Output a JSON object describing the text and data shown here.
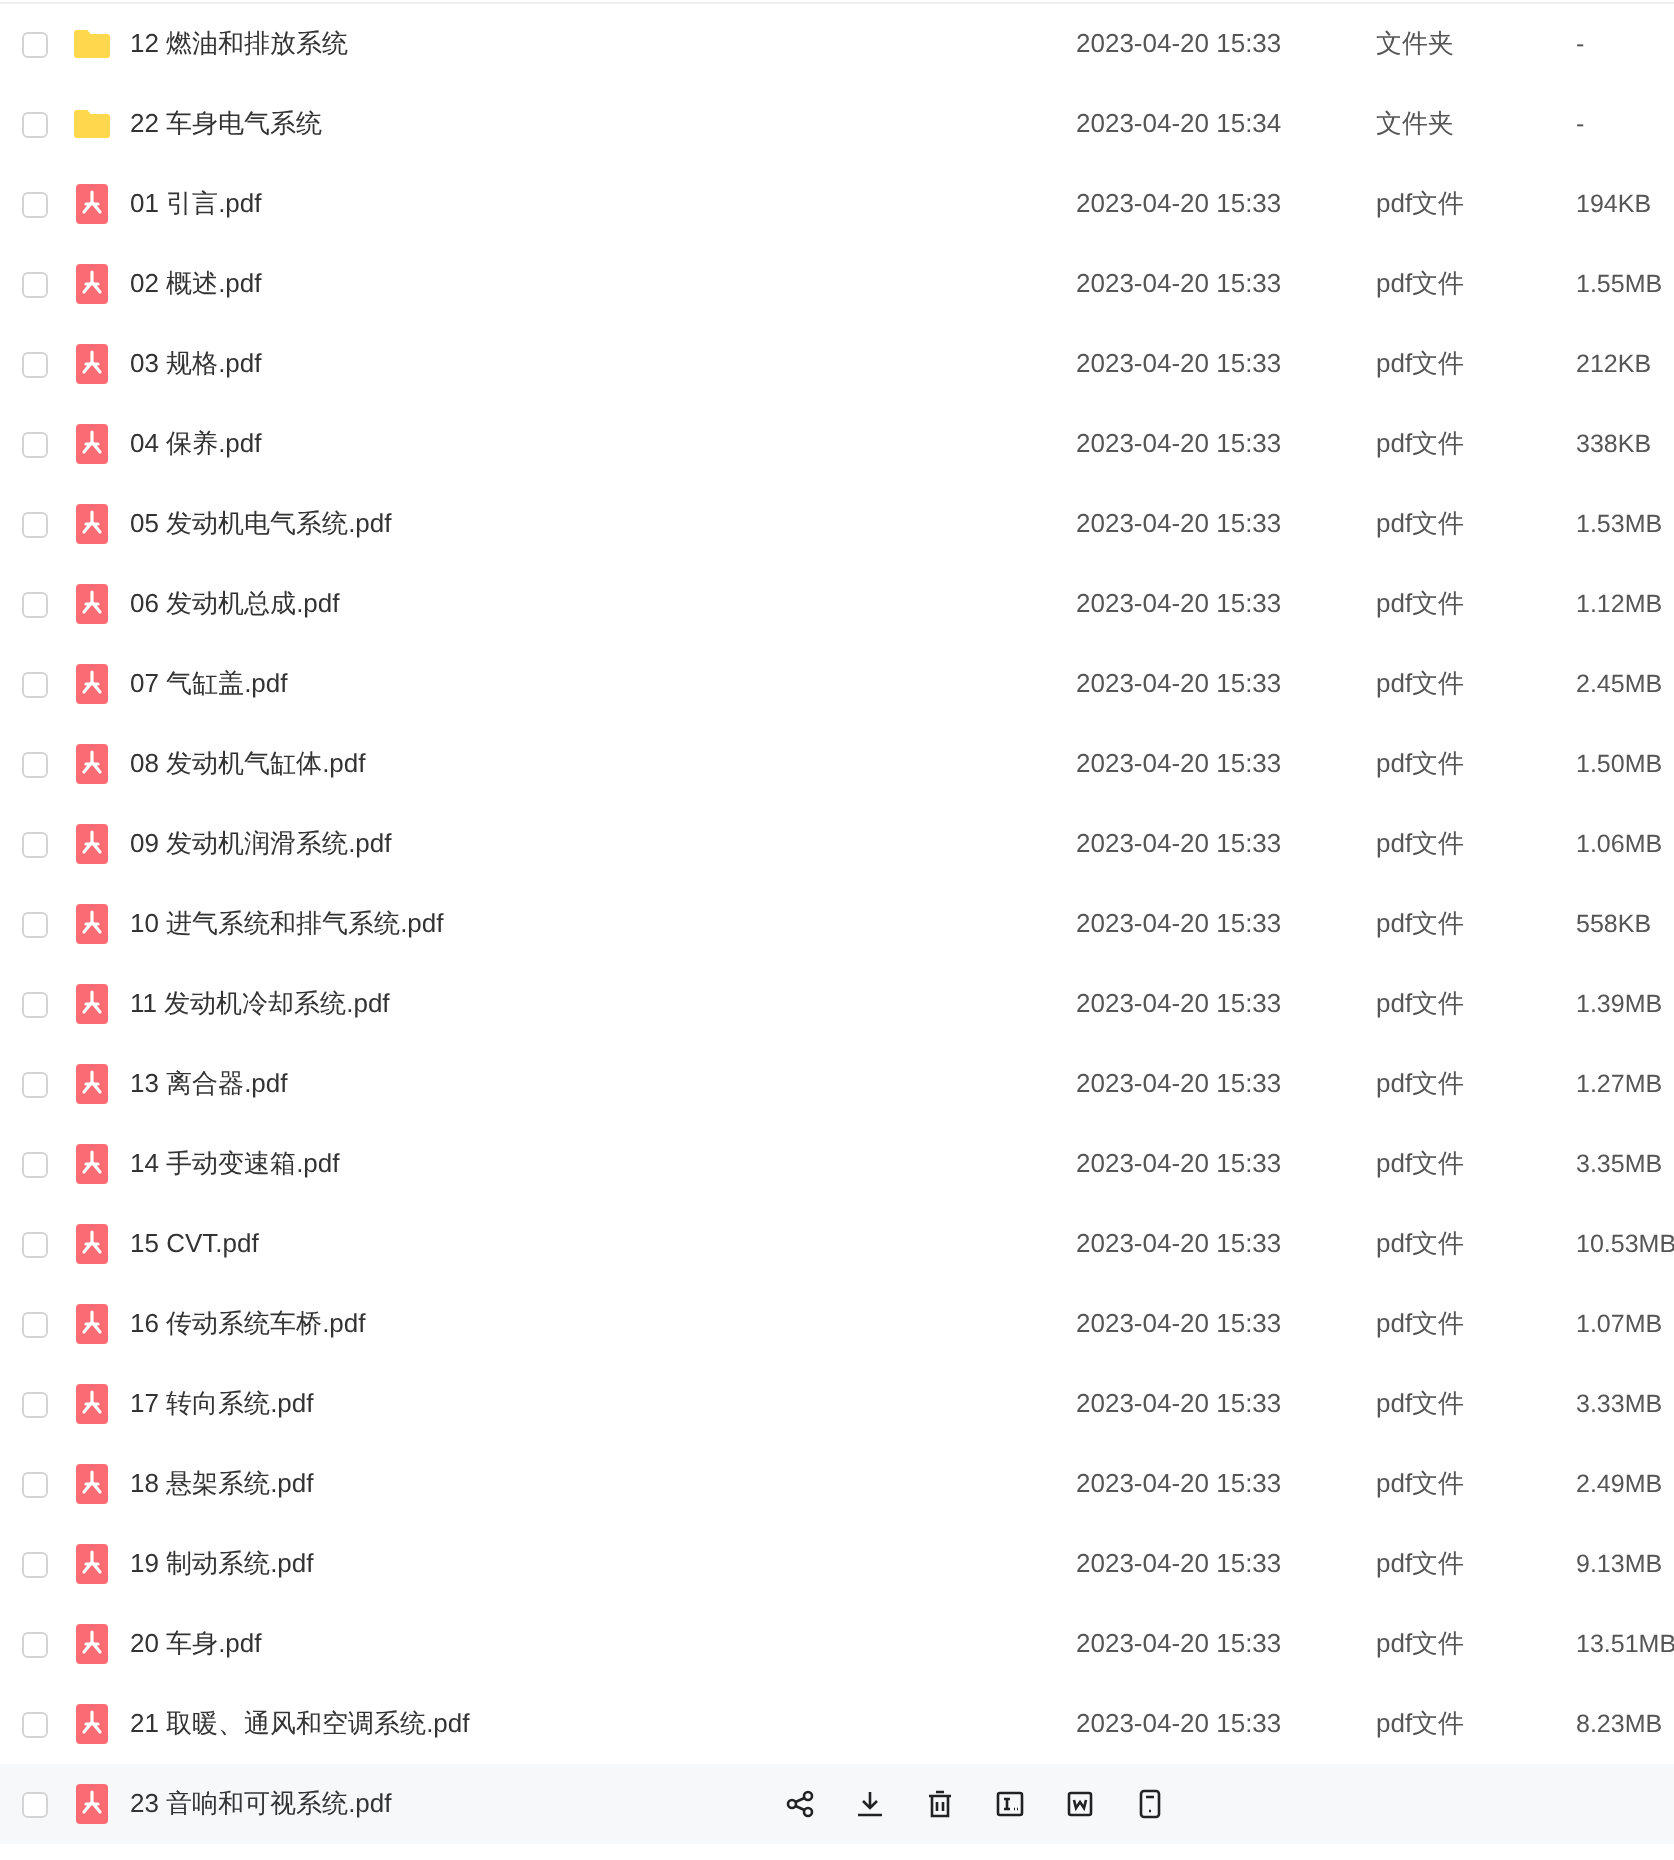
{
  "rows": [
    {
      "kind": "folder",
      "name": "12 燃油和排放系统",
      "date": "2023-04-20 15:33",
      "type": "文件夹",
      "size": "-",
      "checked": false,
      "hovered": false
    },
    {
      "kind": "folder",
      "name": "22 车身电气系统",
      "date": "2023-04-20 15:34",
      "type": "文件夹",
      "size": "-",
      "checked": false,
      "hovered": false
    },
    {
      "kind": "pdf",
      "name": "01 引言.pdf",
      "date": "2023-04-20 15:33",
      "type": "pdf文件",
      "size": "194KB",
      "checked": false,
      "hovered": false
    },
    {
      "kind": "pdf",
      "name": "02 概述.pdf",
      "date": "2023-04-20 15:33",
      "type": "pdf文件",
      "size": "1.55MB",
      "checked": false,
      "hovered": false
    },
    {
      "kind": "pdf",
      "name": "03 规格.pdf",
      "date": "2023-04-20 15:33",
      "type": "pdf文件",
      "size": "212KB",
      "checked": false,
      "hovered": false
    },
    {
      "kind": "pdf",
      "name": "04 保养.pdf",
      "date": "2023-04-20 15:33",
      "type": "pdf文件",
      "size": "338KB",
      "checked": false,
      "hovered": false
    },
    {
      "kind": "pdf",
      "name": "05 发动机电气系统.pdf",
      "date": "2023-04-20 15:33",
      "type": "pdf文件",
      "size": "1.53MB",
      "checked": false,
      "hovered": false
    },
    {
      "kind": "pdf",
      "name": "06 发动机总成.pdf",
      "date": "2023-04-20 15:33",
      "type": "pdf文件",
      "size": "1.12MB",
      "checked": false,
      "hovered": false
    },
    {
      "kind": "pdf",
      "name": "07 气缸盖.pdf",
      "date": "2023-04-20 15:33",
      "type": "pdf文件",
      "size": "2.45MB",
      "checked": false,
      "hovered": false
    },
    {
      "kind": "pdf",
      "name": "08 发动机气缸体.pdf",
      "date": "2023-04-20 15:33",
      "type": "pdf文件",
      "size": "1.50MB",
      "checked": false,
      "hovered": false
    },
    {
      "kind": "pdf",
      "name": "09 发动机润滑系统.pdf",
      "date": "2023-04-20 15:33",
      "type": "pdf文件",
      "size": "1.06MB",
      "checked": false,
      "hovered": false
    },
    {
      "kind": "pdf",
      "name": "10 进气系统和排气系统.pdf",
      "date": "2023-04-20 15:33",
      "type": "pdf文件",
      "size": "558KB",
      "checked": false,
      "hovered": false
    },
    {
      "kind": "pdf",
      "name": "11 发动机冷却系统.pdf",
      "date": "2023-04-20 15:33",
      "type": "pdf文件",
      "size": "1.39MB",
      "checked": false,
      "hovered": false
    },
    {
      "kind": "pdf",
      "name": "13 离合器.pdf",
      "date": "2023-04-20 15:33",
      "type": "pdf文件",
      "size": "1.27MB",
      "checked": false,
      "hovered": false
    },
    {
      "kind": "pdf",
      "name": "14 手动变速箱.pdf",
      "date": "2023-04-20 15:33",
      "type": "pdf文件",
      "size": "3.35MB",
      "checked": false,
      "hovered": false
    },
    {
      "kind": "pdf",
      "name": "15 CVT.pdf",
      "date": "2023-04-20 15:33",
      "type": "pdf文件",
      "size": "10.53MB",
      "checked": false,
      "hovered": false
    },
    {
      "kind": "pdf",
      "name": "16 传动系统车桥.pdf",
      "date": "2023-04-20 15:33",
      "type": "pdf文件",
      "size": "1.07MB",
      "checked": false,
      "hovered": false
    },
    {
      "kind": "pdf",
      "name": "17 转向系统.pdf",
      "date": "2023-04-20 15:33",
      "type": "pdf文件",
      "size": "3.33MB",
      "checked": false,
      "hovered": false
    },
    {
      "kind": "pdf",
      "name": "18 悬架系统.pdf",
      "date": "2023-04-20 15:33",
      "type": "pdf文件",
      "size": "2.49MB",
      "checked": false,
      "hovered": false
    },
    {
      "kind": "pdf",
      "name": "19 制动系统.pdf",
      "date": "2023-04-20 15:33",
      "type": "pdf文件",
      "size": "9.13MB",
      "checked": false,
      "hovered": false
    },
    {
      "kind": "pdf",
      "name": "20 车身.pdf",
      "date": "2023-04-20 15:33",
      "type": "pdf文件",
      "size": "13.51MB",
      "checked": false,
      "hovered": false
    },
    {
      "kind": "pdf",
      "name": "21 取暖、通风和空调系统.pdf",
      "date": "2023-04-20 15:33",
      "type": "pdf文件",
      "size": "8.23MB",
      "checked": false,
      "hovered": false
    },
    {
      "kind": "pdf",
      "name": "23 音响和可视系统.pdf",
      "checked": false,
      "hovered": true
    }
  ]
}
